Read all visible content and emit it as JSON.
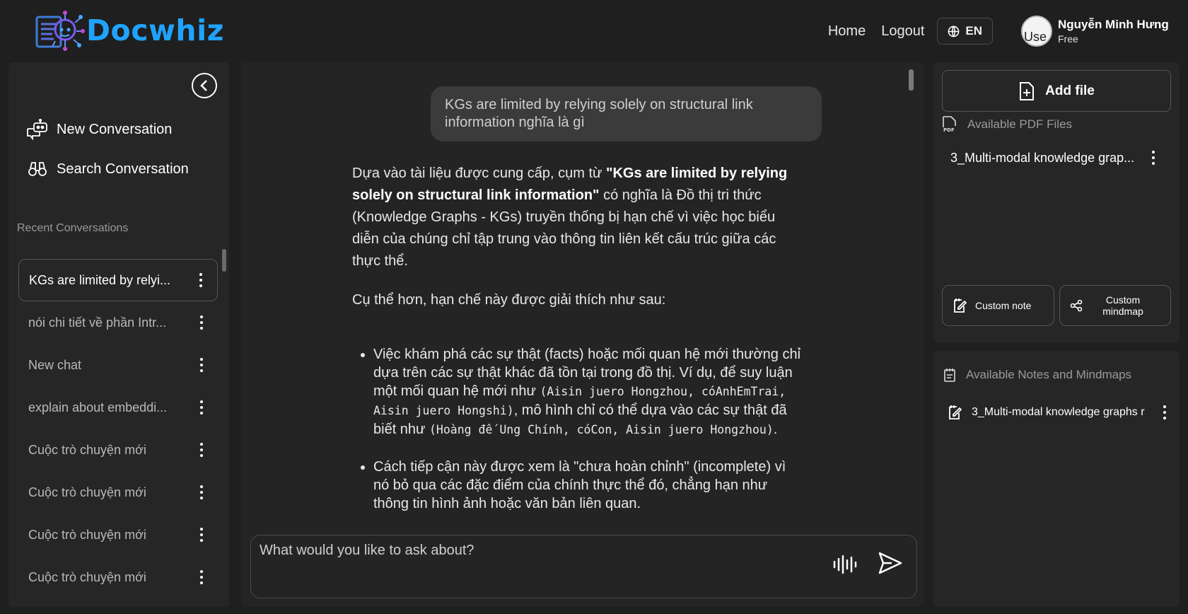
{
  "app": {
    "brand": "Docwhiz",
    "brand_color": "#1fa3ff"
  },
  "header": {
    "nav_home": "Home",
    "nav_logout": "Logout",
    "language": "EN",
    "user_name": "Nguyễn Minh Hưng",
    "user_plan": "Free",
    "avatar_alt": "Use"
  },
  "sidebar": {
    "new_conversation": "New Conversation",
    "search_conversation": "Search Conversation",
    "recent_label": "Recent Conversations",
    "conversations": [
      {
        "label": "KGs are limited by relyi..."
      },
      {
        "label": "nói chi tiết về phần Intr..."
      },
      {
        "label": "New chat"
      },
      {
        "label": "explain about embeddi..."
      },
      {
        "label": "Cuộc trò chuyện mới"
      },
      {
        "label": "Cuộc trò chuyện mới"
      },
      {
        "label": "Cuộc trò chuyện mới"
      },
      {
        "label": "Cuộc trò chuyện mới"
      }
    ]
  },
  "chat": {
    "user_message": "KGs are limited by relying solely on structural link information nghĩa là gì",
    "answer": {
      "p1_prefix": "Dựa vào tài liệu được cung cấp, cụm từ ",
      "p1_bold": "\"KGs are limited by relying solely on structural link information\"",
      "p1_suffix": " có nghĩa là Đồ thị tri thức (Knowledge Graphs - KGs) truyền thống bị hạn chế vì việc học biểu diễn của chúng chỉ tập trung vào thông tin liên kết cấu trúc giữa các thực thể.",
      "p2": "Cụ thể hơn, hạn chế này được giải thích như sau:",
      "b1_prefix": "Việc khám phá các sự thật (facts) hoặc mối quan hệ mới thường chỉ dựa trên các sự thật khác đã tồn tại trong đồ thị. Ví dụ, để suy luận một mối quan hệ mới như ",
      "b1_code1": "(Aisin juero Hongzhou, cóAnhEmTrai, Aisin juero Hongshi)",
      "b1_mid": ", mô hình chỉ có thể dựa vào các sự thật đã biết như ",
      "b1_code2": "(Hoàng đế Ung Chính, cóCon, Aisin juero Hongzhou)",
      "b1_end": ".",
      "b2": "Cách tiếp cận này được xem là \"chưa hoàn chỉnh\" (incomplete) vì nó bỏ qua các đặc điểm của chính thực thể đó, chẳng hạn như thông tin hình ảnh hoặc văn bản liên quan."
    },
    "input_placeholder": "What would you like to ask about?"
  },
  "right_panel": {
    "add_file": "Add file",
    "pdf_section": "Available PDF Files",
    "pdf_files": [
      {
        "label": "3_Multi-modal knowledge grap..."
      }
    ],
    "custom_note": "Custom note",
    "custom_mindmap": "Custom mindmap",
    "notes_section": "Available Notes and Mindmaps",
    "notes": [
      {
        "label": "3_Multi-modal knowledge graphs r"
      }
    ]
  }
}
